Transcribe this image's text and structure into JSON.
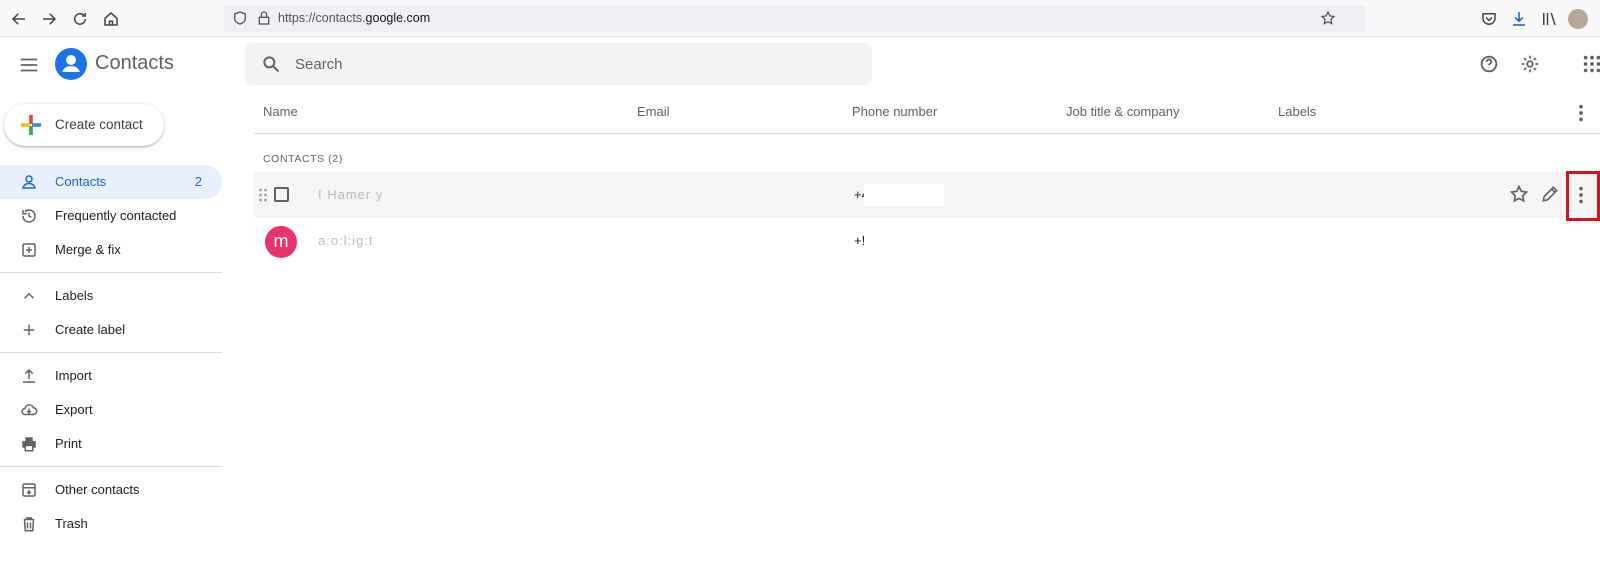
{
  "browser": {
    "url_prefix": "https://contacts.",
    "url_domain": "google.com"
  },
  "app": {
    "title": "Contacts"
  },
  "search": {
    "placeholder": "Search"
  },
  "sidebar": {
    "create_label": "Create contact",
    "items": [
      {
        "label": "Contacts",
        "count": "2"
      },
      {
        "label": "Frequently contacted"
      },
      {
        "label": "Merge & fix"
      },
      {
        "label": "Labels"
      },
      {
        "label": "Create label"
      },
      {
        "label": "Import"
      },
      {
        "label": "Export"
      },
      {
        "label": "Print"
      },
      {
        "label": "Other contacts"
      },
      {
        "label": "Trash"
      }
    ]
  },
  "table": {
    "columns": [
      "Name",
      "Email",
      "Phone number",
      "Job title & company",
      "Labels"
    ],
    "section_title": "CONTACTS (2)",
    "rows": [
      {
        "name": "I Hamer y",
        "phone": "+4"
      },
      {
        "avatar_letter": "m",
        "avatar_color": "#e8336d",
        "name": "a:o:l:ig:t",
        "phone": "+!"
      }
    ]
  },
  "colors": {
    "accent": "#1a73e8",
    "active_bg": "#e8f0fe",
    "highlight": "#d9131d"
  }
}
